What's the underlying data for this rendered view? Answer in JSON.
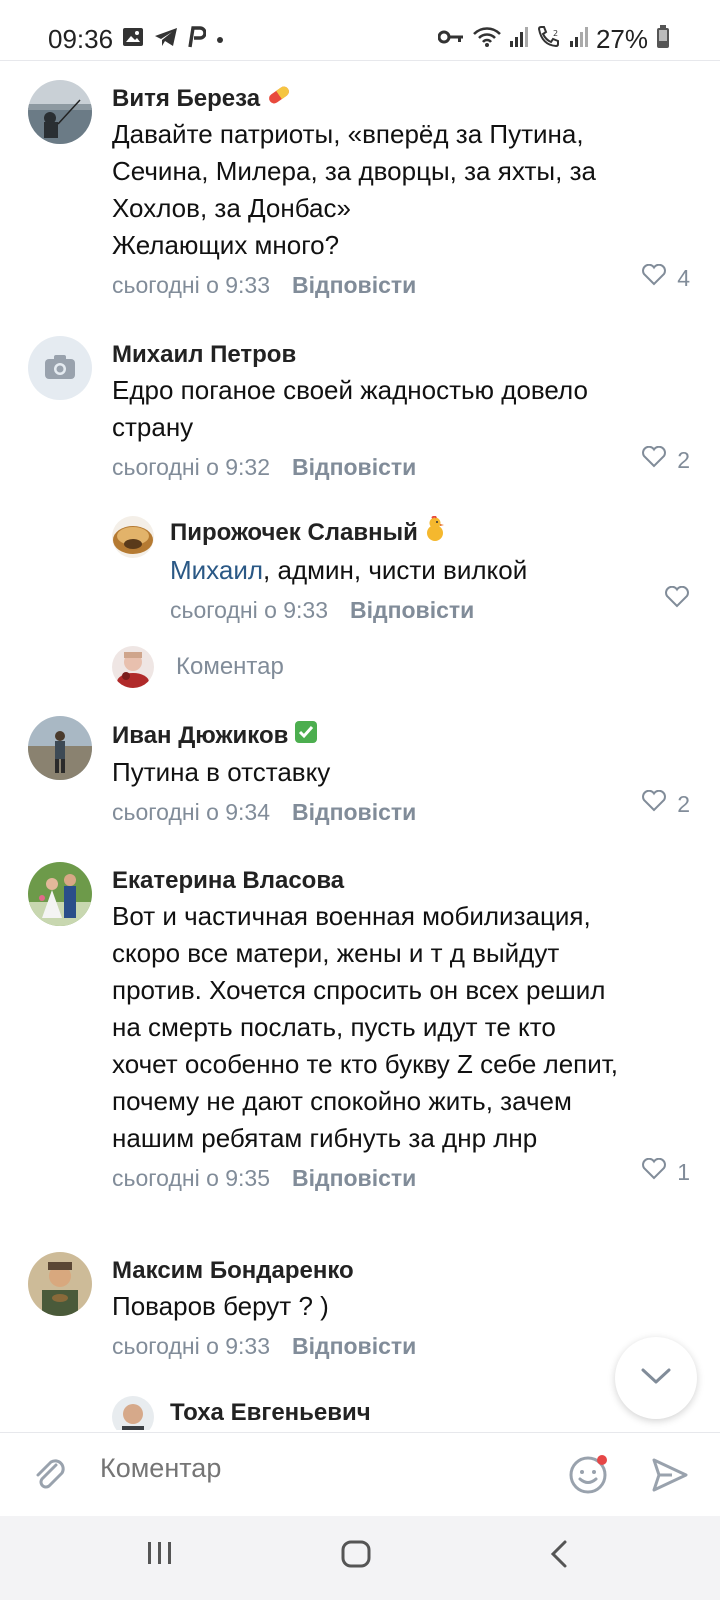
{
  "status_bar": {
    "time": "09:36",
    "battery": "27%"
  },
  "comments": [
    {
      "author": "Витя Береза",
      "badge": "pill",
      "lines": [
        "Давайте патриоты, «вперёд за Путина,",
        "Сечина, Милера, за дворцы, за яхты, за",
        "Хохлов, за Донбас»",
        "Желающих много?"
      ],
      "time": "сьогодні о 9:33",
      "reply_label": "Відповісти",
      "likes": "4"
    },
    {
      "author": "Михаил Петров",
      "lines": [
        "Едро поганое своей жадностью довело",
        "страну"
      ],
      "time": "сьогодні о 9:32",
      "reply_label": "Відповісти",
      "likes": "2"
    },
    {
      "author": "Пирожочек Славный",
      "badge": "chick",
      "mention": "Михаил",
      "text_after_mention": ", админ, чисти вилкой",
      "time": "сьогодні о 9:33",
      "reply_label": "Відповісти",
      "likes": ""
    },
    {
      "author": "Иван Дюжиков",
      "badge": "check",
      "lines": [
        "Путина в отставку"
      ],
      "time": "сьогодні о 9:34",
      "reply_label": "Відповісти",
      "likes": "2"
    },
    {
      "author": "Екатерина Власова",
      "lines": [
        "Вот и частичная военная мобилизация,",
        "скоро все матери, жены  и т д выйдут",
        "против. Хочется спросить он всех решил",
        "на смерть послать, пусть идут те кто",
        "хочет особенно те кто букву Z себе лепит,",
        "почему не дают спокойно жить, зачем",
        "нашим ребятам  гибнуть за днр лнр"
      ],
      "time": "сьогодні о 9:35",
      "reply_label": "Відповісти",
      "likes": "1"
    },
    {
      "author": "Максим Бондаренко",
      "lines": [
        "Поваров берут ? )"
      ],
      "time": "сьогодні о 9:33",
      "reply_label": "Відповісти",
      "likes": ""
    },
    {
      "author": "Тоха Евгеньевич"
    }
  ],
  "thread_reply_placeholder": "Коментар",
  "composer": {
    "placeholder": "Коментар"
  },
  "colors": {
    "accent": "#2a5885",
    "meta": "#818c99",
    "badge_dot": "#e64646"
  }
}
